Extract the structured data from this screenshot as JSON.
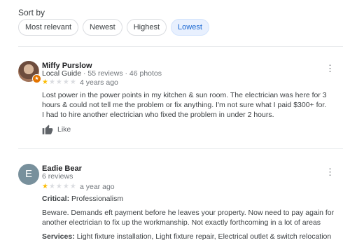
{
  "sort": {
    "label": "Sort by",
    "options": [
      {
        "label": "Most relevant",
        "selected": false
      },
      {
        "label": "Newest",
        "selected": false
      },
      {
        "label": "Highest",
        "selected": false
      },
      {
        "label": "Lowest",
        "selected": true
      }
    ]
  },
  "reviews": [
    {
      "author": "Miffy Purslow",
      "author_level": "Local Guide",
      "author_stats": " · 55 reviews · 46 photos",
      "rating": 1,
      "max_rating": 5,
      "time": "4 years ago",
      "text_line1": "Lost power in the power points in my kitchen & sun room. The electrician was here for 3 hours & could not tell me the problem or fix anything. I'm not sure what I paid $300+ for.",
      "text_line2": "I had to hire another electrician who fixed the problem in under 2 hours.",
      "like_label": "Like"
    },
    {
      "author": "Eadie Bear",
      "avatar_letter": "E",
      "author_stats": "6 reviews",
      "rating": 1,
      "max_rating": 5,
      "time": "a year ago",
      "critical_label": "Critical:",
      "critical_value": " Professionalism",
      "text": "Beware. Demands eft payment before he leaves your property. Now need to pay again for another electrician to fix up the workmanship. Not exactly forthcoming in a lot of areas",
      "services_label": "Services:",
      "services_value": " Light fixture installation, Light fixture repair, Electrical outlet & switch relocation"
    }
  ],
  "colors": {
    "star": "#fbbc04",
    "selected_chip": "#e8f0fe",
    "guide_badge": "#e37400"
  }
}
